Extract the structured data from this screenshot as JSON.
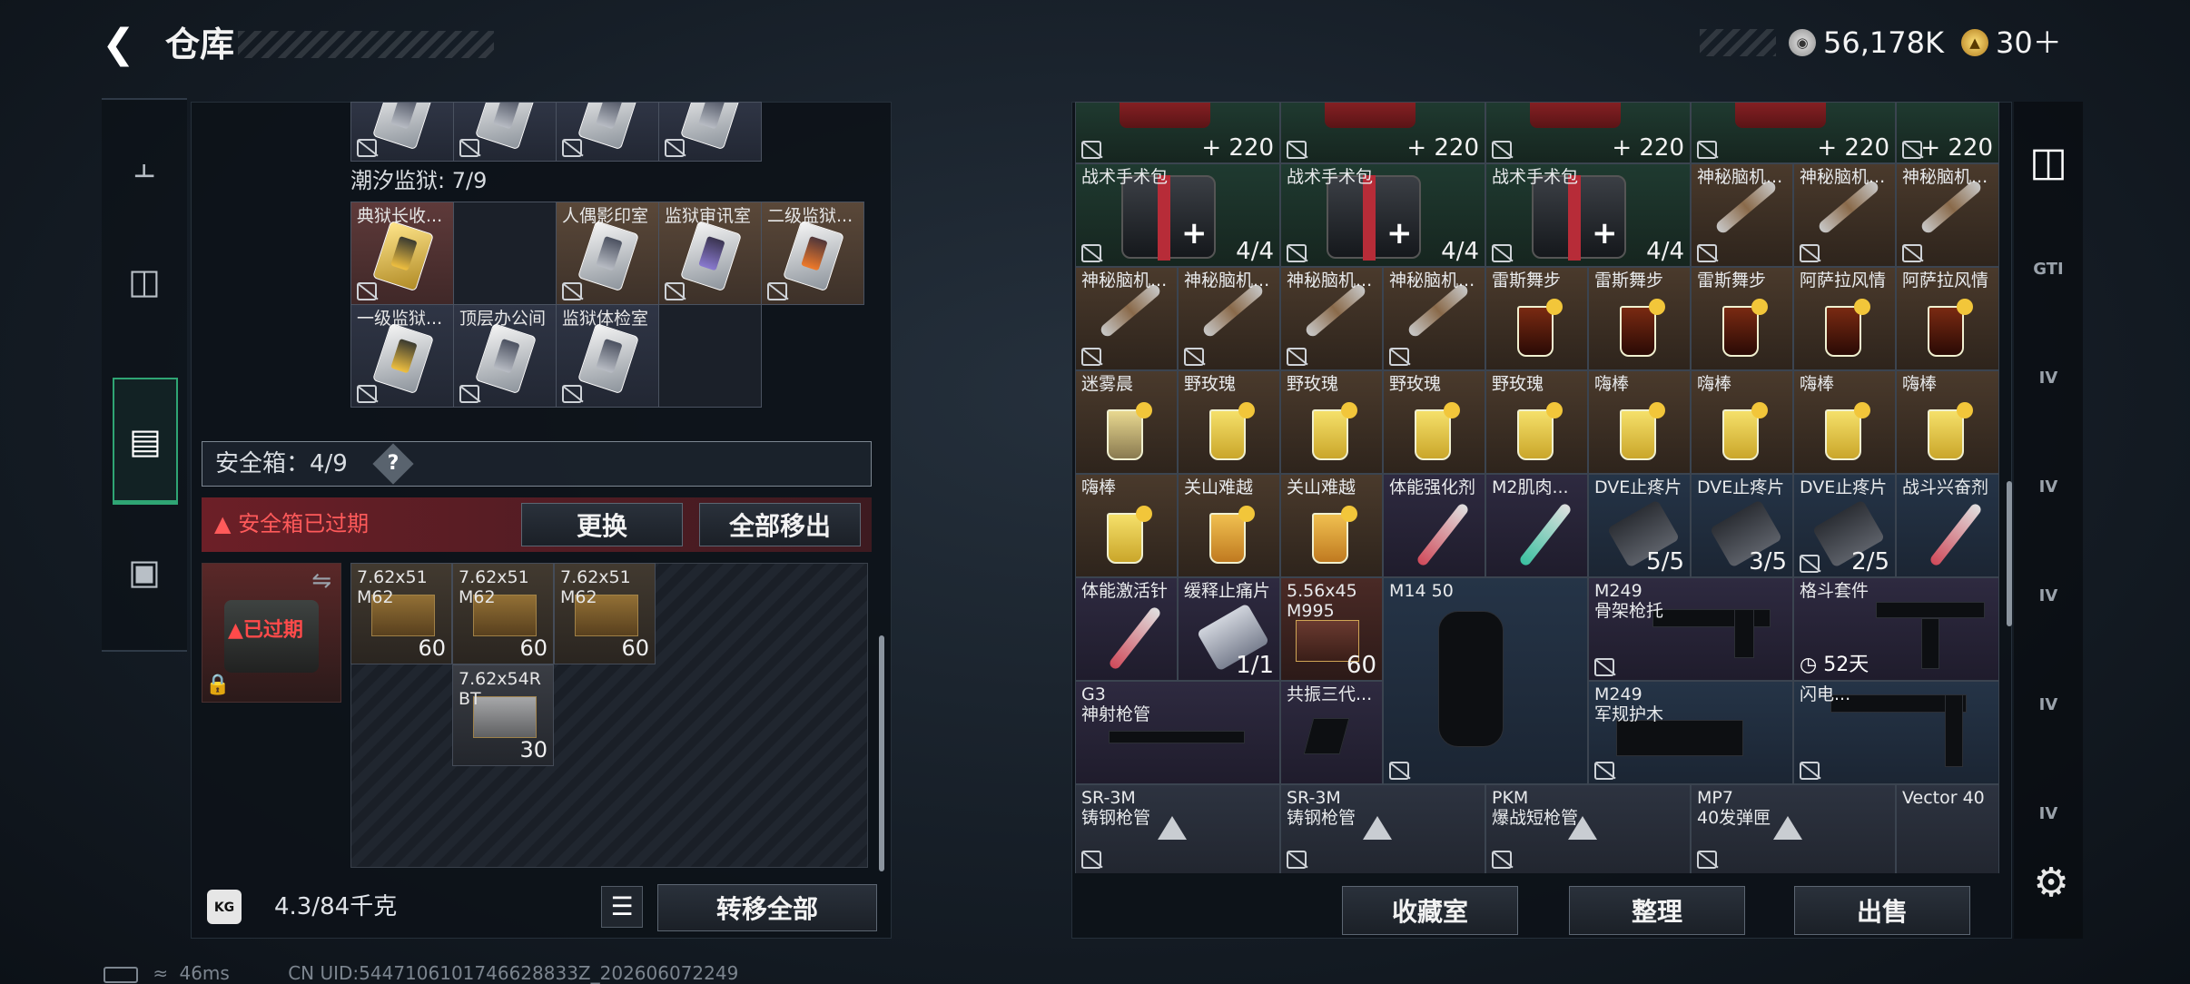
{
  "header": {
    "title": "仓库"
  },
  "currency": {
    "coins": "56,178K",
    "tickets": "30＋"
  },
  "sidebar": {
    "tabs": [
      {
        "icon": "pistol-icon"
      },
      {
        "icon": "vest-icon"
      },
      {
        "icon": "backpack-icon"
      },
      {
        "icon": "toolbox-icon"
      }
    ]
  },
  "left": {
    "section_prison": "潮汐监狱: 7/9",
    "keycards": [
      {
        "name": "典狱长收..."
      },
      {
        "name": ""
      },
      {
        "name": "人偶影印室"
      },
      {
        "name": "监狱审讯室"
      },
      {
        "name": "二级监狱..."
      },
      {
        "name": "一级监狱..."
      },
      {
        "name": "顶层办公间"
      },
      {
        "name": "监狱体检室"
      }
    ],
    "safebox": {
      "label": "安全箱：4/9",
      "help": "?"
    },
    "expired": {
      "warning": "▲ 安全箱已过期",
      "replace": "更换",
      "move_all": "全部移出",
      "tag": "▲已过期"
    },
    "ammo": [
      {
        "name": "7.62x51",
        "name2": "M62",
        "count": "60"
      },
      {
        "name": "7.62x51",
        "name2": "M62",
        "count": "60"
      },
      {
        "name": "7.62x51",
        "name2": "M62",
        "count": "60"
      },
      {
        "name": "7.62x54R",
        "name2": "BT",
        "count": "30"
      }
    ],
    "weight": "4.3/84千克",
    "kg_icon": "KG",
    "transfer_all": "转移全部"
  },
  "status": {
    "ping": "46ms",
    "uid": "CN UID:5447106101746628833Z_202606072249"
  },
  "right": {
    "top_counts": [
      "220",
      "220",
      "220",
      "220",
      "220"
    ],
    "items": [
      {
        "name": "战术手术包",
        "count": "4/4"
      },
      {
        "name": "战术手术包",
        "count": "4/4"
      },
      {
        "name": "战术手术包",
        "count": "4/4"
      },
      {
        "name": "神秘脑机..."
      },
      {
        "name": "神秘脑机..."
      },
      {
        "name": "神秘脑机..."
      },
      {
        "name": "神秘脑机..."
      },
      {
        "name": "神秘脑机..."
      },
      {
        "name": "神秘脑机..."
      },
      {
        "name": "神秘脑机..."
      },
      {
        "name": "雷斯舞步"
      },
      {
        "name": "雷斯舞步"
      },
      {
        "name": "雷斯舞步"
      },
      {
        "name": "阿萨拉风情"
      },
      {
        "name": "阿萨拉风情"
      },
      {
        "name": "迷雾晨"
      },
      {
        "name": "野玫瑰"
      },
      {
        "name": "野玫瑰"
      },
      {
        "name": "野玫瑰"
      },
      {
        "name": "野玫瑰"
      },
      {
        "name": "嗨棒"
      },
      {
        "name": "嗨棒"
      },
      {
        "name": "嗨棒"
      },
      {
        "name": "嗨棒"
      },
      {
        "name": "嗨棒"
      },
      {
        "name": "关山难越"
      },
      {
        "name": "关山难越"
      },
      {
        "name": "体能强化剂"
      },
      {
        "name": "M2肌肉..."
      },
      {
        "name": "DVE止疼片",
        "count": "5/5"
      },
      {
        "name": "DVE止疼片",
        "count": "3/5"
      },
      {
        "name": "DVE止疼片",
        "count": "2/5"
      },
      {
        "name": "战斗兴奋剂"
      },
      {
        "name": "体能激活针"
      },
      {
        "name": "缓释止痛片",
        "count": "1/1"
      },
      {
        "name": "5.56x45",
        "name2": "M995",
        "count": "60"
      },
      {
        "name": "M14 50"
      },
      {
        "name": "M249",
        "name2": "骨架枪托"
      },
      {
        "name": "格斗套件",
        "timer": "52天"
      },
      {
        "name": "G3",
        "name2": "神射枪管"
      },
      {
        "name": "共振三代..."
      },
      {
        "name": "M249",
        "name2": "军规护木"
      },
      {
        "name": "闪电..."
      },
      {
        "name": "SR-3M",
        "name2": "铸钢枪管"
      },
      {
        "name": "SR-3M",
        "name2": "铸钢枪管"
      },
      {
        "name": "PKM",
        "name2": "爆战短枪管"
      },
      {
        "name": "MP7",
        "name2": "40发弹匣"
      },
      {
        "name": "Vector 40"
      }
    ],
    "buttons": {
      "collection": "收藏室",
      "organize": "整理",
      "sell": "出售"
    }
  },
  "right_nav": [
    {
      "icon": "vault-icon"
    },
    {
      "label": "GTI"
    },
    {
      "label": "IV"
    },
    {
      "label": "IV"
    },
    {
      "label": "IV"
    },
    {
      "label": "IV"
    },
    {
      "label": "IV"
    }
  ],
  "colors": {
    "accent_green": "#2fa574",
    "warning_red": "#ff5a5a",
    "expired_bg": "#6c1f27"
  }
}
